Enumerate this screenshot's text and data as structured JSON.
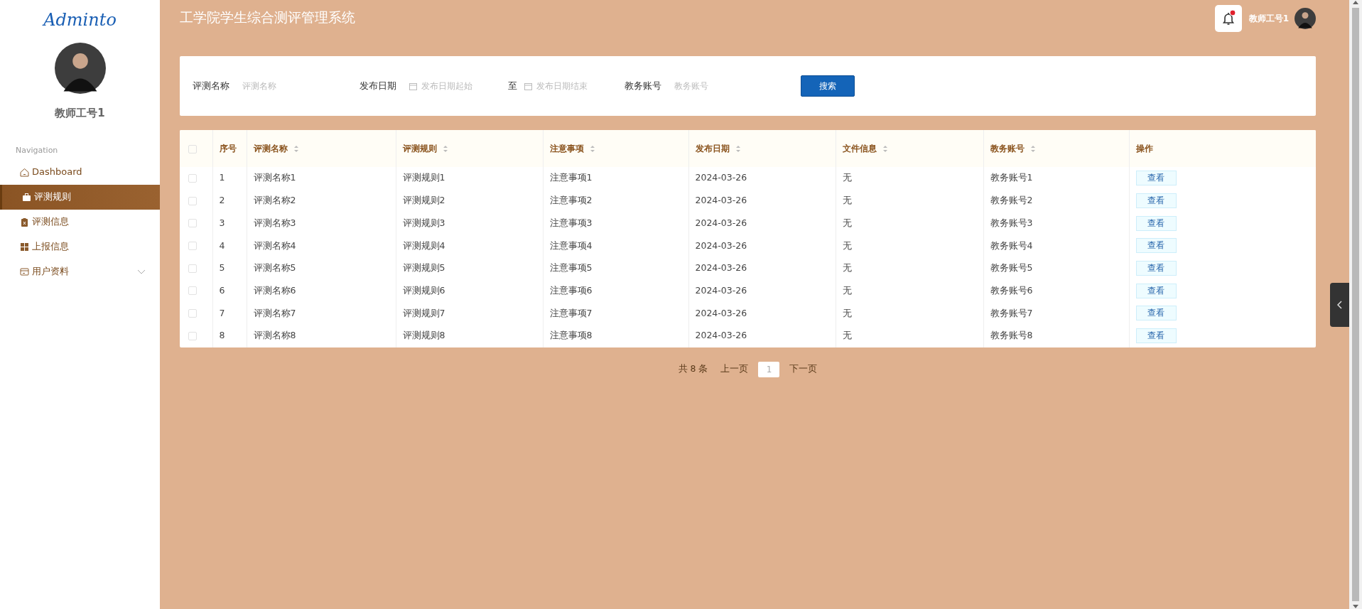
{
  "sidebar": {
    "logo": "Adminto",
    "user_name": "教师工号1",
    "section_title": "Navigation",
    "items": [
      {
        "label": "Dashboard",
        "selected": false,
        "has_submenu": false
      },
      {
        "label": "评测规则",
        "selected": true,
        "has_submenu": false
      },
      {
        "label": "评测信息",
        "selected": false,
        "has_submenu": false
      },
      {
        "label": "上报信息",
        "selected": false,
        "has_submenu": false
      },
      {
        "label": "用户资料",
        "selected": false,
        "has_submenu": true
      }
    ]
  },
  "header": {
    "title": "工学院学生综合测评管理系统",
    "has_notification": true,
    "user_name": "教师工号1"
  },
  "search": {
    "fields": [
      {
        "kind": "text",
        "label": "评测名称",
        "placeholder": "评测名称"
      },
      {
        "kind": "date_range",
        "label": "发布日期",
        "start_placeholder": "发布日期起始",
        "separator": "至",
        "end_placeholder": "发布日期结束"
      },
      {
        "kind": "text",
        "label": "教务账号",
        "placeholder": "教务账号"
      }
    ],
    "button": "搜索"
  },
  "table": {
    "select_all": false,
    "columns": [
      {
        "label": "序号",
        "sortable": false
      },
      {
        "label": "评测名称",
        "sortable": true
      },
      {
        "label": "评测规则",
        "sortable": true
      },
      {
        "label": "注意事项",
        "sortable": true
      },
      {
        "label": "发布日期",
        "sortable": true
      },
      {
        "label": "文件信息",
        "sortable": true
      },
      {
        "label": "教务账号",
        "sortable": true
      },
      {
        "label": "操作",
        "sortable": false
      }
    ],
    "rows": [
      {
        "selected": false,
        "cells": [
          "1",
          "评测名称1",
          "评测规则1",
          "注意事项1",
          "2024-03-26",
          "无",
          "教务账号1"
        ],
        "action": "查看"
      },
      {
        "selected": false,
        "cells": [
          "2",
          "评测名称2",
          "评测规则2",
          "注意事项2",
          "2024-03-26",
          "无",
          "教务账号2"
        ],
        "action": "查看"
      },
      {
        "selected": false,
        "cells": [
          "3",
          "评测名称3",
          "评测规则3",
          "注意事项3",
          "2024-03-26",
          "无",
          "教务账号3"
        ],
        "action": "查看"
      },
      {
        "selected": false,
        "cells": [
          "4",
          "评测名称4",
          "评测规则4",
          "注意事项4",
          "2024-03-26",
          "无",
          "教务账号4"
        ],
        "action": "查看"
      },
      {
        "selected": false,
        "cells": [
          "5",
          "评测名称5",
          "评测规则5",
          "注意事项5",
          "2024-03-26",
          "无",
          "教务账号5"
        ],
        "action": "查看"
      },
      {
        "selected": false,
        "cells": [
          "6",
          "评测名称6",
          "评测规则6",
          "注意事项6",
          "2024-03-26",
          "无",
          "教务账号6"
        ],
        "action": "查看"
      },
      {
        "selected": false,
        "cells": [
          "7",
          "评测名称7",
          "评测规则7",
          "注意事项7",
          "2024-03-26",
          "无",
          "教务账号7"
        ],
        "action": "查看"
      },
      {
        "selected": false,
        "cells": [
          "8",
          "评测名称8",
          "评测规则8",
          "注意事项8",
          "2024-03-26",
          "无",
          "教务账号8"
        ],
        "action": "查看"
      }
    ]
  },
  "pagination": {
    "total": "共 8 条",
    "prev": "上一页",
    "pages": [
      {
        "label": "1",
        "selected": true
      }
    ],
    "next": "下一页"
  }
}
